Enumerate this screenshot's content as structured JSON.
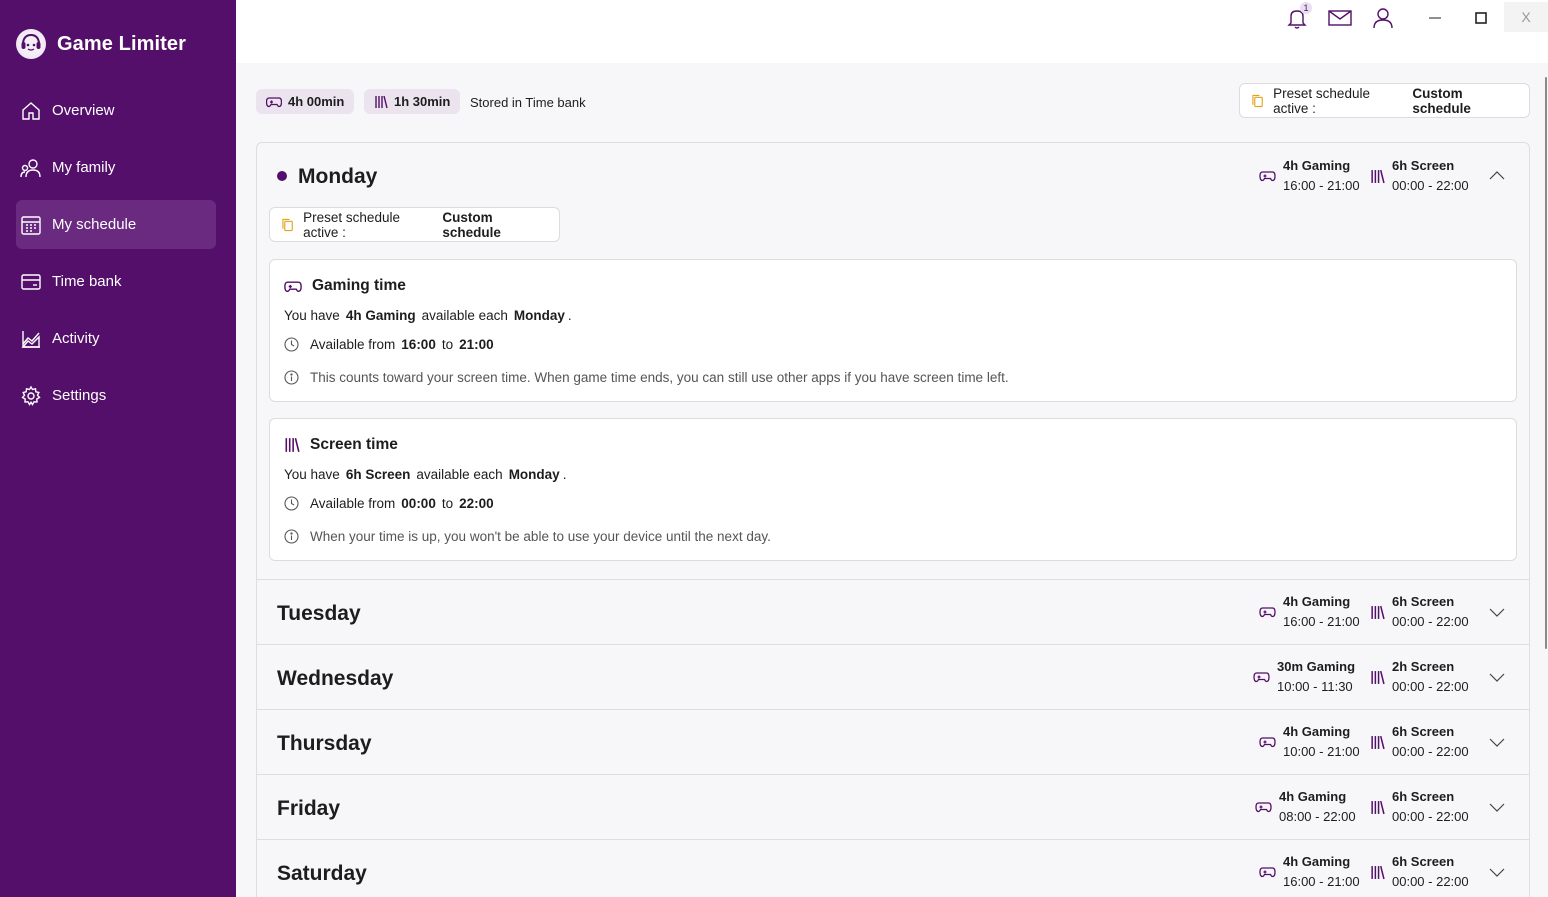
{
  "app": {
    "title": "Game Limiter"
  },
  "sidebar": {
    "items": [
      {
        "label": "Overview",
        "icon": "home-icon"
      },
      {
        "label": "My family",
        "icon": "family-icon"
      },
      {
        "label": "My schedule",
        "icon": "calendar-icon",
        "active": true
      },
      {
        "label": "Time bank",
        "icon": "wallet-icon"
      },
      {
        "label": "Activity",
        "icon": "chart-icon"
      },
      {
        "label": "Settings",
        "icon": "gear-icon"
      }
    ]
  },
  "topbar": {
    "notification_count": "1",
    "close_label": "X"
  },
  "bank": {
    "gaming_chip": "4h 00min",
    "screen_chip": "1h 30min",
    "stored_label": "Stored in Time bank"
  },
  "preset": {
    "label": "Preset schedule active :",
    "value": "Custom schedule"
  },
  "days": [
    {
      "name": "Monday",
      "gaming": "4h Gaming",
      "gaming_range": "16:00 - 21:00",
      "screen": "6h Screen",
      "screen_range": "00:00 - 22:00"
    },
    {
      "name": "Tuesday",
      "gaming": "4h Gaming",
      "gaming_range": "16:00 - 21:00",
      "screen": "6h Screen",
      "screen_range": "00:00 - 22:00"
    },
    {
      "name": "Wednesday",
      "gaming": "30m Gaming",
      "gaming_range": "10:00 - 11:30",
      "screen": "2h Screen",
      "screen_range": "00:00 - 22:00"
    },
    {
      "name": "Thursday",
      "gaming": "4h Gaming",
      "gaming_range": "10:00 - 21:00",
      "screen": "6h Screen",
      "screen_range": "00:00 - 22:00"
    },
    {
      "name": "Friday",
      "gaming": "4h Gaming",
      "gaming_range": "08:00 - 22:00",
      "screen": "6h Screen",
      "screen_range": "00:00 - 22:00"
    },
    {
      "name": "Saturday",
      "gaming": "4h Gaming",
      "gaming_range": "16:00 - 21:00",
      "screen": "6h Screen",
      "screen_range": "00:00 - 22:00"
    }
  ],
  "monday_detail": {
    "gaming": {
      "title": "Gaming time",
      "you_have": "You have",
      "amount": "4h Gaming",
      "available_each": "available each",
      "day": "Monday",
      "period": ".",
      "available_from": "Available from",
      "from": "16:00",
      "to_word": "to",
      "to": "21:00",
      "note": "This counts toward your screen time. When game time ends, you can still use other apps if you have screen time left."
    },
    "screen": {
      "title": "Screen time",
      "you_have": "You have",
      "amount": "6h Screen",
      "available_each": "available each",
      "day": "Monday",
      "period": ".",
      "available_from": "Available from",
      "from": "00:00",
      "to_word": "to",
      "to": "22:00",
      "note": "When your time is up, you won't be able to use your device until the next day."
    }
  },
  "colors": {
    "sidebar": "#530f69",
    "accent": "#530f69",
    "chip_bg": "#ebe3ee",
    "preset_icon": "#e3a21a"
  }
}
